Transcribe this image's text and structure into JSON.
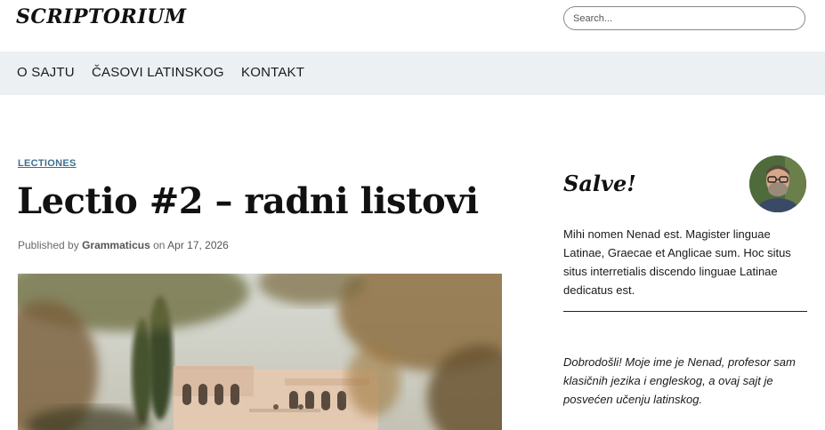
{
  "site": {
    "logo": "SCRIPTORIUM"
  },
  "search": {
    "placeholder": "Search..."
  },
  "nav": {
    "items": [
      {
        "label": "O SAJTU"
      },
      {
        "label": "ČASOVI LATINSKOG"
      },
      {
        "label": "KONTAKT"
      }
    ]
  },
  "post": {
    "category": "LECTIONES",
    "title": "Lectio #2 – radni listovi",
    "meta": {
      "published_by": "Published by",
      "author": "Grammaticus",
      "on": "on",
      "date": "Apr 17, 2026"
    }
  },
  "sidebar": {
    "heading": "Salve!",
    "bio": "Mihi nomen Nenad est. Magister linguae Latinae, Graecae et Anglicae sum. Hoc situs situs interretialis discendo linguae Latinae dedicatus est.",
    "welcome": "Dobrodošli! Moje ime je Nenad, profesor sam klasičnih jezika i engleskog, a ovaj sajt je posvećen učenju latinskog."
  },
  "colors": {
    "nav_background": "#ecf0f3",
    "category_link": "#3d6f8f",
    "divider": "#222222"
  }
}
